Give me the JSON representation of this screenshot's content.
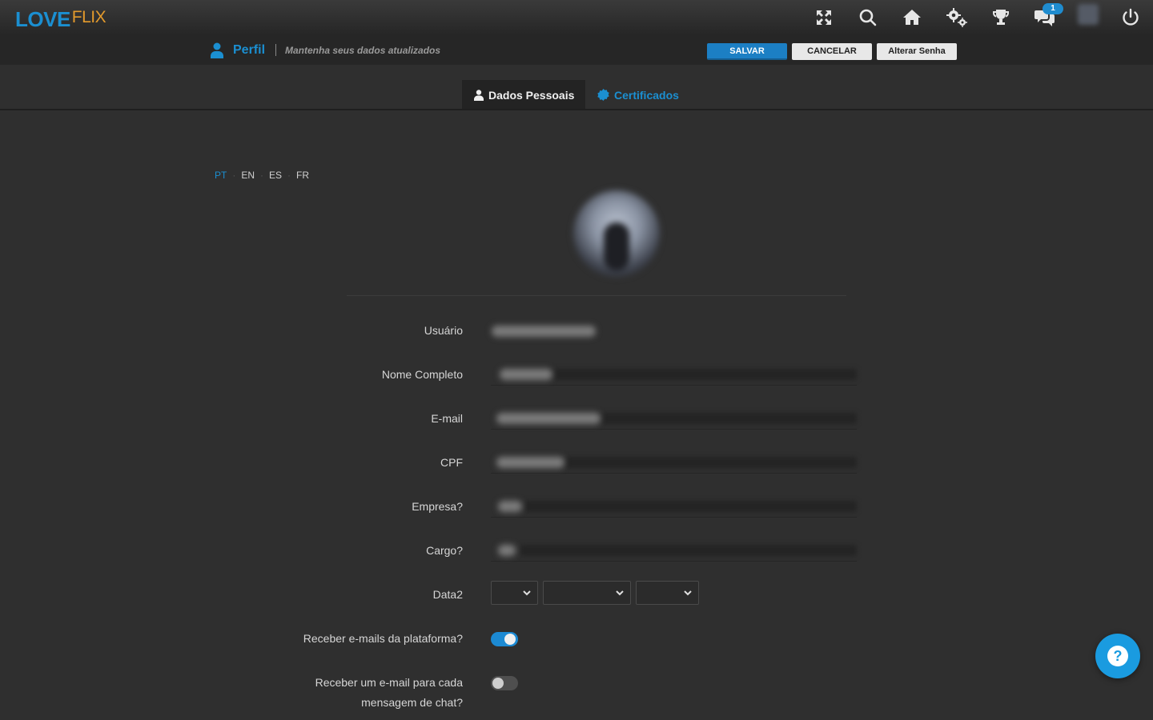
{
  "brand": {
    "love": "LOVE",
    "flix": "FLIX"
  },
  "topbar": {
    "icons": [
      "fullscreen-icon",
      "search-icon",
      "home-icon",
      "settings-icon",
      "trophy-icon",
      "chat-icon",
      "user-avatar",
      "power-icon"
    ],
    "chat_badge": "1"
  },
  "subbar": {
    "title": "Perfil",
    "subtitle": "Mantenha seus dados atualizados",
    "save_label": "SALVAR",
    "cancel_label": "CANCELAR",
    "change_password_label": "Alterar Senha"
  },
  "tabs": [
    {
      "label": "Dados Pessoais",
      "active": true
    },
    {
      "label": "Certificados",
      "active": false
    }
  ],
  "languages": [
    "PT",
    "EN",
    "ES",
    "FR"
  ],
  "active_language": "PT",
  "form": {
    "usuario_label": "Usuário",
    "nome_label": "Nome Completo",
    "email_label": "E-mail",
    "cpf_label": "CPF",
    "empresa_label": "Empresa?",
    "cargo_label": "Cargo?",
    "data_label": "Data2",
    "receber_emails_label": "Receber e-mails da plataforma?",
    "receber_chat_line1": "Receber um e-mail para cada",
    "receber_chat_line2": "mensagem de chat?"
  },
  "toggles": {
    "receber_emails": true,
    "receber_chat": false
  },
  "help_glyph": "?",
  "colors": {
    "accent": "#1b8fd1",
    "brand_orange": "#e39a2c",
    "background": "#2f2f2f"
  }
}
